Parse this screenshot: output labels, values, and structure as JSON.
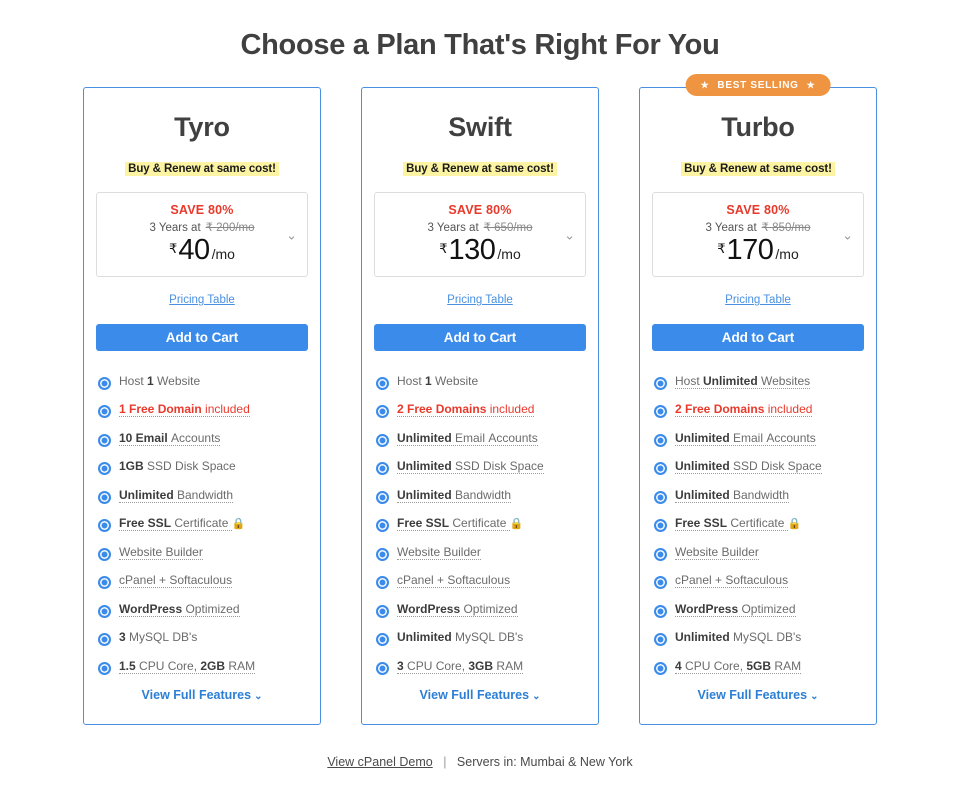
{
  "page": {
    "title": "Choose a Plan That's Right For You"
  },
  "labels": {
    "renew_note": "Buy & Renew at same cost!",
    "save_label": "SAVE 80%",
    "term_prefix": "3 Years at",
    "per_month": "/mo",
    "rupee": "₹",
    "pricing_table": "Pricing Table",
    "add_to_cart": "Add to Cart",
    "view_full_features": "View Full Features",
    "chevron_down": "⌄",
    "star": "★",
    "lock": "🔒"
  },
  "colors": {
    "accent_blue": "#3b8beb",
    "card_border": "#4a90e2",
    "badge_orange": "#ef9440",
    "save_red": "#e8392b",
    "highlight_yellow": "#fcf4a3",
    "lock_green": "#2fbd4a"
  },
  "plans": [
    {
      "name": "Tyro",
      "badge": null,
      "save": "SAVE 80%",
      "old_price": "₹ 200/mo",
      "price": "40",
      "features": [
        {
          "parts": [
            {
              "t": "Host ",
              "b": false
            },
            {
              "t": "1",
              "b": true
            },
            {
              "t": " Website",
              "b": false
            }
          ],
          "red": false,
          "tip": false
        },
        {
          "parts": [
            {
              "t": "1 Free Domain",
              "b": true
            },
            {
              "t": " included",
              "b": false
            }
          ],
          "red": true,
          "tip": true
        },
        {
          "parts": [
            {
              "t": "10 Email",
              "b": true
            },
            {
              "t": " Accounts",
              "b": false
            }
          ],
          "red": false,
          "tip": true
        },
        {
          "parts": [
            {
              "t": "1GB",
              "b": true
            },
            {
              "t": " SSD Disk Space",
              "b": false
            }
          ],
          "red": false,
          "tip": false
        },
        {
          "parts": [
            {
              "t": "Unlimited",
              "b": true
            },
            {
              "t": " Bandwidth",
              "b": false
            }
          ],
          "red": false,
          "tip": true
        },
        {
          "parts": [
            {
              "t": "Free SSL",
              "b": true
            },
            {
              "t": " Certificate ",
              "b": false
            }
          ],
          "red": false,
          "tip": true,
          "lock": true
        },
        {
          "parts": [
            {
              "t": "Website Builder",
              "b": false
            }
          ],
          "red": false,
          "tip": true
        },
        {
          "parts": [
            {
              "t": "cPanel + Softaculous",
              "b": false
            }
          ],
          "red": false,
          "tip": true
        },
        {
          "parts": [
            {
              "t": "WordPress",
              "b": true
            },
            {
              "t": " Optimized",
              "b": false
            }
          ],
          "red": false,
          "tip": true
        },
        {
          "parts": [
            {
              "t": "3",
              "b": true
            },
            {
              "t": " MySQL DB's",
              "b": false
            }
          ],
          "red": false,
          "tip": false
        },
        {
          "parts": [
            {
              "t": "1.5",
              "b": true
            },
            {
              "t": " CPU Core, ",
              "b": false
            },
            {
              "t": "2GB",
              "b": true
            },
            {
              "t": " RAM",
              "b": false
            }
          ],
          "red": false,
          "tip": true
        }
      ]
    },
    {
      "name": "Swift",
      "badge": null,
      "save": "SAVE 80%",
      "old_price": "₹ 650/mo",
      "price": "130",
      "features": [
        {
          "parts": [
            {
              "t": "Host ",
              "b": false
            },
            {
              "t": "1",
              "b": true
            },
            {
              "t": " Website",
              "b": false
            }
          ],
          "red": false,
          "tip": false
        },
        {
          "parts": [
            {
              "t": "2 Free Domains",
              "b": true
            },
            {
              "t": " included",
              "b": false
            }
          ],
          "red": true,
          "tip": true
        },
        {
          "parts": [
            {
              "t": "Unlimited",
              "b": true
            },
            {
              "t": " Email Accounts",
              "b": false
            }
          ],
          "red": false,
          "tip": true
        },
        {
          "parts": [
            {
              "t": "Unlimited",
              "b": true
            },
            {
              "t": " SSD Disk Space",
              "b": false
            }
          ],
          "red": false,
          "tip": true
        },
        {
          "parts": [
            {
              "t": "Unlimited",
              "b": true
            },
            {
              "t": " Bandwidth",
              "b": false
            }
          ],
          "red": false,
          "tip": true
        },
        {
          "parts": [
            {
              "t": "Free SSL",
              "b": true
            },
            {
              "t": " Certificate ",
              "b": false
            }
          ],
          "red": false,
          "tip": true,
          "lock": true
        },
        {
          "parts": [
            {
              "t": "Website Builder",
              "b": false
            }
          ],
          "red": false,
          "tip": true
        },
        {
          "parts": [
            {
              "t": "cPanel + Softaculous",
              "b": false
            }
          ],
          "red": false,
          "tip": true
        },
        {
          "parts": [
            {
              "t": "WordPress",
              "b": true
            },
            {
              "t": " Optimized",
              "b": false
            }
          ],
          "red": false,
          "tip": true
        },
        {
          "parts": [
            {
              "t": "Unlimited",
              "b": true
            },
            {
              "t": " MySQL DB's",
              "b": false
            }
          ],
          "red": false,
          "tip": false
        },
        {
          "parts": [
            {
              "t": "3",
              "b": true
            },
            {
              "t": " CPU Core, ",
              "b": false
            },
            {
              "t": "3GB",
              "b": true
            },
            {
              "t": " RAM",
              "b": false
            }
          ],
          "red": false,
          "tip": true
        }
      ]
    },
    {
      "name": "Turbo",
      "badge": "BEST SELLING",
      "save": "SAVE 80%",
      "old_price": "₹ 850/mo",
      "price": "170",
      "features": [
        {
          "parts": [
            {
              "t": "Host ",
              "b": false
            },
            {
              "t": "Unlimited",
              "b": true
            },
            {
              "t": " Websites",
              "b": false
            }
          ],
          "red": false,
          "tip": true
        },
        {
          "parts": [
            {
              "t": "2 Free Domains",
              "b": true
            },
            {
              "t": " included",
              "b": false
            }
          ],
          "red": true,
          "tip": true
        },
        {
          "parts": [
            {
              "t": "Unlimited",
              "b": true
            },
            {
              "t": " Email Accounts",
              "b": false
            }
          ],
          "red": false,
          "tip": true
        },
        {
          "parts": [
            {
              "t": "Unlimited",
              "b": true
            },
            {
              "t": " SSD Disk Space",
              "b": false
            }
          ],
          "red": false,
          "tip": true
        },
        {
          "parts": [
            {
              "t": "Unlimited",
              "b": true
            },
            {
              "t": " Bandwidth",
              "b": false
            }
          ],
          "red": false,
          "tip": true
        },
        {
          "parts": [
            {
              "t": "Free SSL",
              "b": true
            },
            {
              "t": " Certificate ",
              "b": false
            }
          ],
          "red": false,
          "tip": true,
          "lock": true
        },
        {
          "parts": [
            {
              "t": "Website Builder",
              "b": false
            }
          ],
          "red": false,
          "tip": true
        },
        {
          "parts": [
            {
              "t": "cPanel + Softaculous",
              "b": false
            }
          ],
          "red": false,
          "tip": true
        },
        {
          "parts": [
            {
              "t": "WordPress",
              "b": true
            },
            {
              "t": " Optimized",
              "b": false
            }
          ],
          "red": false,
          "tip": true
        },
        {
          "parts": [
            {
              "t": "Unlimited",
              "b": true
            },
            {
              "t": " MySQL DB's",
              "b": false
            }
          ],
          "red": false,
          "tip": false
        },
        {
          "parts": [
            {
              "t": "4",
              "b": true
            },
            {
              "t": " CPU Core, ",
              "b": false
            },
            {
              "t": "5GB",
              "b": true
            },
            {
              "t": " RAM",
              "b": false
            }
          ],
          "red": false,
          "tip": true
        }
      ]
    }
  ],
  "footer": {
    "demo_link": "View cPanel Demo",
    "separator": "|",
    "servers_text": "Servers in: Mumbai & New York"
  }
}
